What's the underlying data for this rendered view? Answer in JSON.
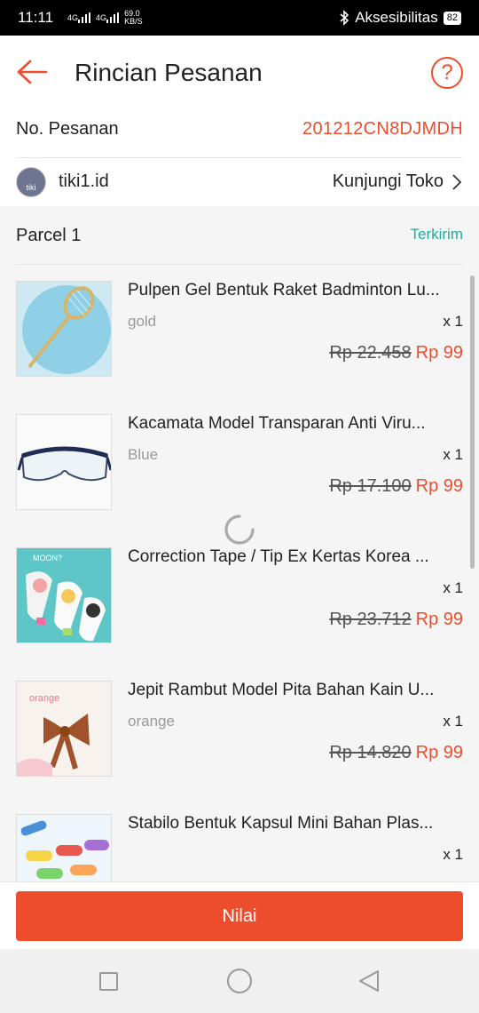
{
  "status_bar": {
    "time": "11:11",
    "network_signal_1": "4G",
    "network_signal_2": "4G",
    "speed": "69.0",
    "speed_unit": "KB/S",
    "accessibility_label": "Aksesibilitas",
    "battery": "82"
  },
  "header": {
    "title": "Rincian Pesanan",
    "back_icon": "arrow-left-icon",
    "help_icon": "question-circle-icon",
    "help_glyph": "?"
  },
  "order": {
    "label": "No. Pesanan",
    "number": "201212CN8DJMDH"
  },
  "shop": {
    "avatar_text": "tiki",
    "name": "tiki1.id",
    "visit_label": "Kunjungi Toko"
  },
  "parcel": {
    "name": "Parcel 1",
    "status": "Terkirim"
  },
  "items": [
    {
      "name": "Pulpen Gel Bentuk Raket Badminton Lu...",
      "variant": "gold",
      "qty": "x 1",
      "old_price": "Rp 22.458",
      "price": "Rp 99"
    },
    {
      "name": "Kacamata Model Transparan Anti Viru...",
      "variant": "Blue",
      "qty": "x 1",
      "old_price": "Rp 17.100",
      "price": "Rp 99"
    },
    {
      "name": "Correction Tape / Tip Ex Kertas Korea ...",
      "variant": "",
      "qty": "x 1",
      "old_price": "Rp 23.712",
      "price": "Rp 99"
    },
    {
      "name": "Jepit Rambut Model Pita Bahan Kain U...",
      "variant": "orange",
      "qty": "x 1",
      "old_price": "Rp 14.820",
      "price": "Rp 99"
    },
    {
      "name": "Stabilo Bentuk Kapsul Mini Bahan Plas...",
      "variant": "",
      "qty": "x 1",
      "old_price": "",
      "price": ""
    }
  ],
  "thumb_texts": {
    "moon": "MOON?",
    "orange": "orange"
  },
  "action": {
    "rate_label": "Nilai"
  },
  "colors": {
    "accent": "#ee4d2d",
    "status_green": "#26aa99"
  }
}
